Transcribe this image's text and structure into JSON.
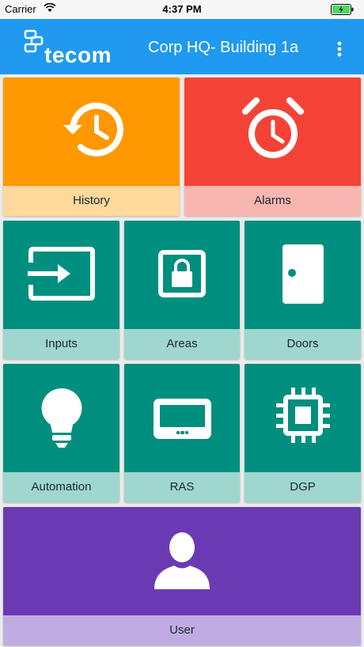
{
  "status_bar": {
    "carrier": "Carrier",
    "time": "4:37 PM"
  },
  "app_bar": {
    "logo_text": "tecom",
    "title": "Corp HQ- Building 1a"
  },
  "tiles": {
    "history": {
      "label": "History",
      "icon": "history-icon"
    },
    "alarms": {
      "label": "Alarms",
      "icon": "alarm-clock-icon"
    },
    "inputs": {
      "label": "Inputs",
      "icon": "input-icon"
    },
    "areas": {
      "label": "Areas",
      "icon": "lock-icon"
    },
    "doors": {
      "label": "Doors",
      "icon": "door-icon"
    },
    "automation": {
      "label": "Automation",
      "icon": "lightbulb-icon"
    },
    "ras": {
      "label": "RAS",
      "icon": "keypad-icon"
    },
    "dgp": {
      "label": "DGP",
      "icon": "chip-icon"
    },
    "user": {
      "label": "User",
      "icon": "user-icon"
    }
  },
  "colors": {
    "app_bar": "#1f9af0",
    "history": "#ff9800",
    "alarms": "#f44336",
    "teal": "#008f7e",
    "user": "#6a3ab4"
  }
}
